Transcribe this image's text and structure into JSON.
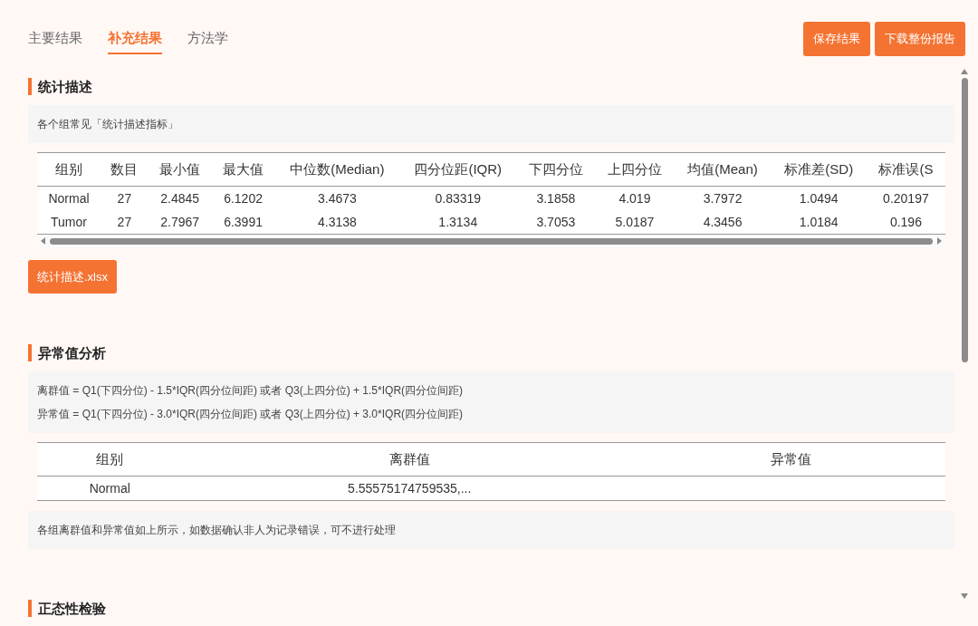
{
  "tabs": [
    {
      "label": "主要结果",
      "selected": false
    },
    {
      "label": "补充结果",
      "selected": true
    },
    {
      "label": "方法学",
      "selected": false
    }
  ],
  "actions": [
    "保存结果",
    "下载整份报告"
  ],
  "sections": [
    {
      "title": "统计描述",
      "notes": [
        "各个组常见「统计描述指标」"
      ],
      "table": {
        "kind": "wide",
        "columns": [
          "组别",
          "数目",
          "最小值",
          "最大值",
          "中位数(Median)",
          "四分位距(IQR)",
          "下四分位",
          "上四分位",
          "均值(Mean)",
          "标准差(SD)",
          "标准误(S"
        ],
        "rows": [
          [
            "Normal",
            "27",
            "2.4845",
            "6.1202",
            "3.4673",
            "0.83319",
            "3.1858",
            "4.019",
            "3.7972",
            "1.0494",
            "0.20197"
          ],
          [
            "Tumor",
            "27",
            "2.7967",
            "6.3991",
            "4.3138",
            "1.3134",
            "3.7053",
            "5.0187",
            "4.3456",
            "1.0184",
            "0.196"
          ]
        ]
      },
      "file_button": "统计描述.xlsx"
    },
    {
      "title": "异常值分析",
      "notes": [
        "离群值 = Q1(下四分位) - 1.5*IQR(四分位间距) 或者 Q3(上四分位) + 1.5*IQR(四分位间距)",
        "异常值 = Q1(下四分位) - 3.0*IQR(四分位间距) 或者 Q3(上四分位) + 3.0*IQR(四分位间距)"
      ],
      "table": {
        "kind": "plain",
        "columns": [
          "组别",
          "离群值",
          "异常值"
        ],
        "rows": [
          [
            "Normal",
            "5.55575174759535,..."
          ]
        ]
      },
      "notes_after": [
        "各组离群值和异常值如上所示，如数据确认非人为记录错误，可不进行处理"
      ]
    },
    {
      "title": "正态性检验"
    }
  ]
}
